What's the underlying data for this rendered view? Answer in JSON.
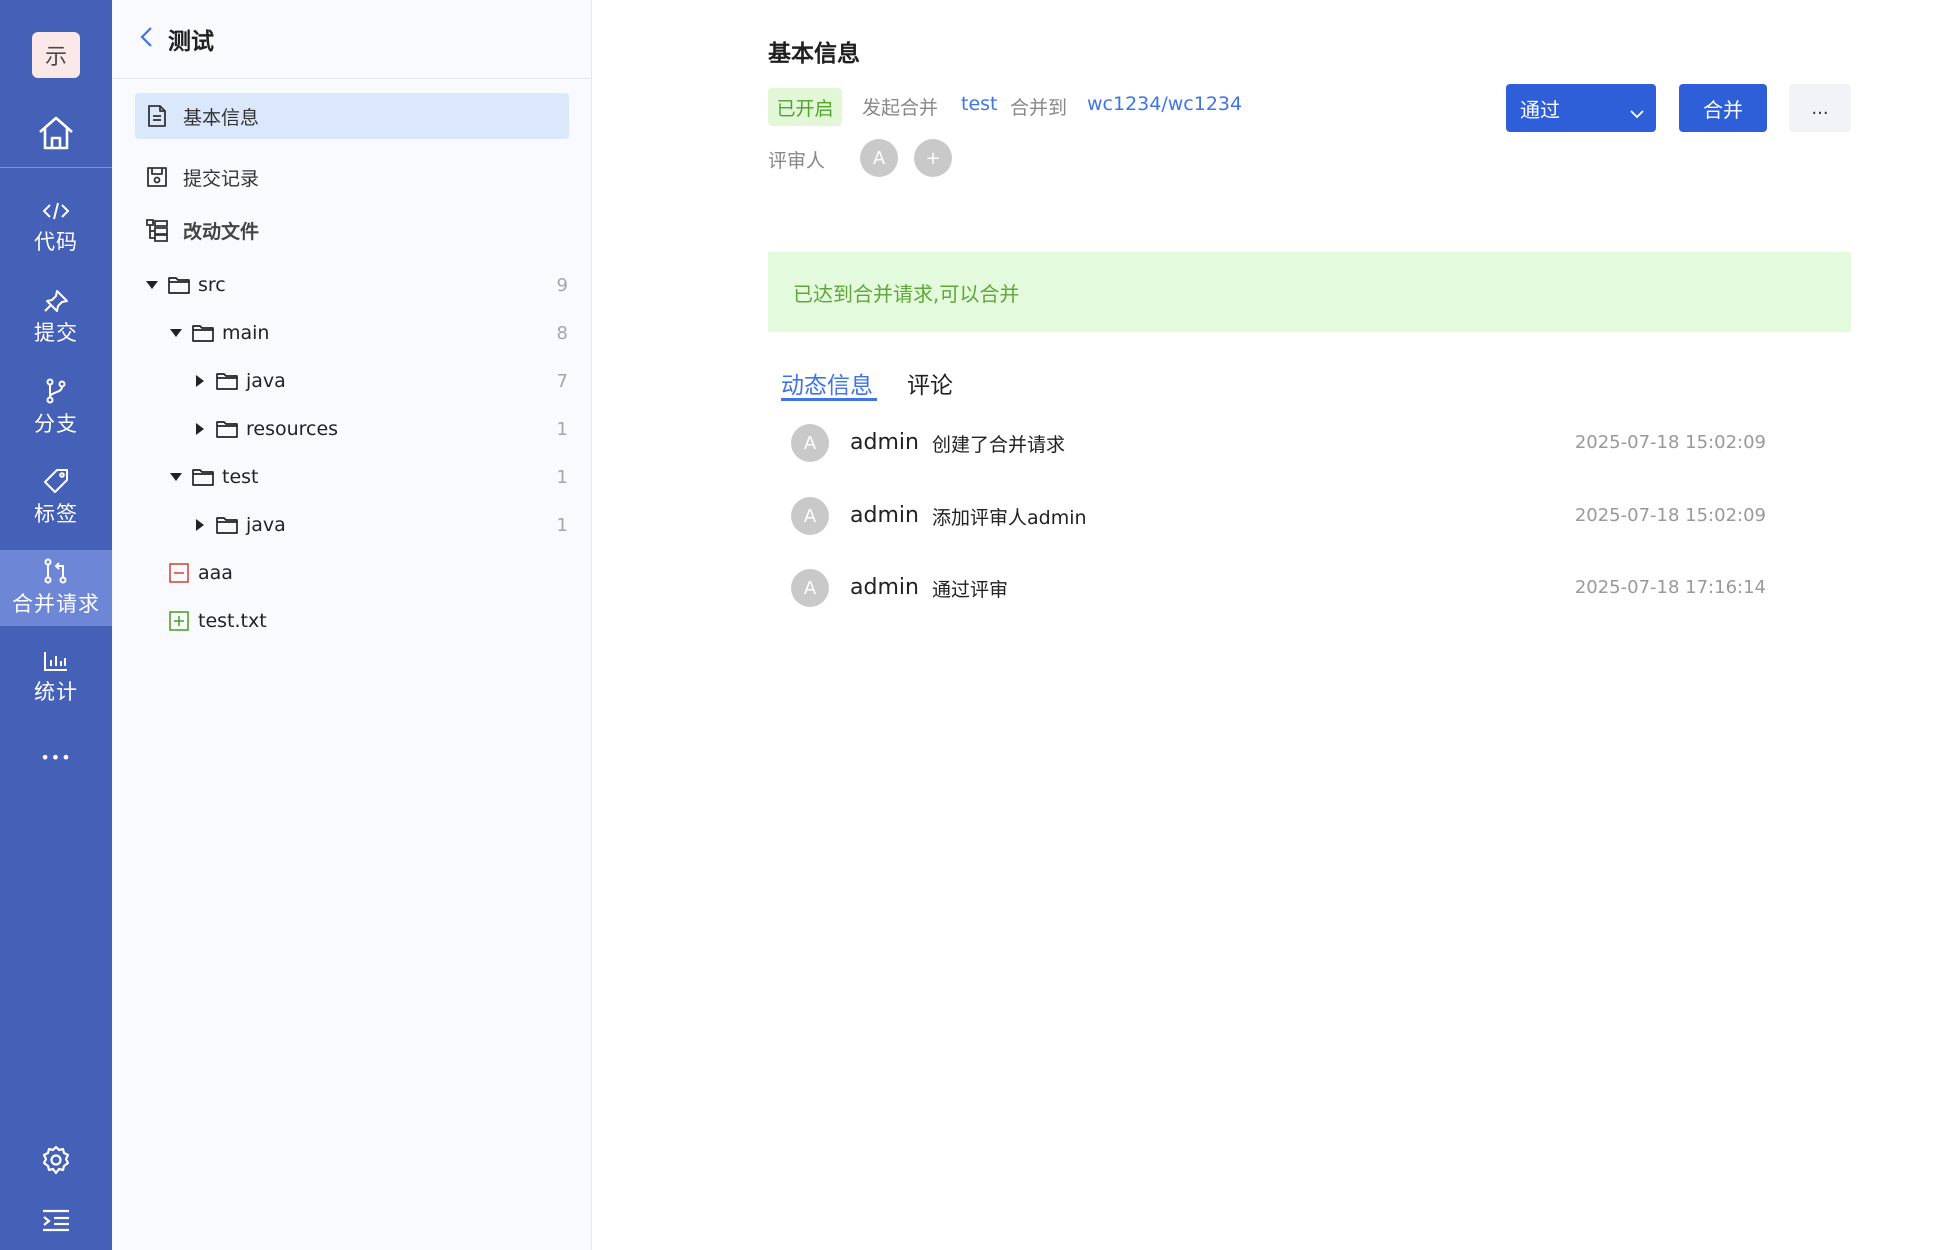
{
  "rail": {
    "logo": "示",
    "items": [
      {
        "label": "代码",
        "icon": "code-icon"
      },
      {
        "label": "提交",
        "icon": "pin-icon"
      },
      {
        "label": "分支",
        "icon": "branch-icon"
      },
      {
        "label": "标签",
        "icon": "tag-icon"
      },
      {
        "label": "合并请求",
        "icon": "merge-request-icon",
        "active": true
      },
      {
        "label": "统计",
        "icon": "chart-icon"
      }
    ],
    "more": "•••"
  },
  "panel": {
    "title": "测试",
    "nav": [
      {
        "label": "基本信息",
        "icon": "document-icon",
        "active": true
      },
      {
        "label": "提交记录",
        "icon": "commit-record-icon"
      },
      {
        "label": "改动文件",
        "icon": "file-tree-icon"
      }
    ],
    "tree": [
      {
        "name": "src",
        "type": "folder",
        "state": "expanded",
        "count": "9"
      },
      {
        "name": "main",
        "type": "folder",
        "state": "expanded",
        "count": "8"
      },
      {
        "name": "java",
        "type": "folder",
        "state": "collapsed",
        "count": "7"
      },
      {
        "name": "resources",
        "type": "folder",
        "state": "collapsed",
        "count": "1"
      },
      {
        "name": "test",
        "type": "folder",
        "state": "expanded",
        "count": "1"
      },
      {
        "name": "java",
        "type": "folder",
        "state": "collapsed",
        "count": "1"
      },
      {
        "name": "aaa",
        "type": "file-deleted",
        "count": ""
      },
      {
        "name": "test.txt",
        "type": "file-added",
        "count": ""
      }
    ]
  },
  "main": {
    "section_title": "基本信息",
    "status": "已开启",
    "initiated_label": "发起合并",
    "source_branch": "test",
    "merge_to_label": "合并到",
    "target": "wc1234/wc1234",
    "reviewer_label": "评审人",
    "reviewer_avatar": "A",
    "add_reviewer": "+",
    "approve_button": "通过",
    "merge_button": "合并",
    "more_button": "...",
    "notice": "已达到合并请求,可以合并",
    "tabs": [
      "动态信息",
      "评论"
    ],
    "activities": [
      {
        "avatar": "A",
        "user": "admin",
        "action": "创建了合并请求",
        "time": "2025-07-18 15:02:09"
      },
      {
        "avatar": "A",
        "user": "admin",
        "action": "添加评审人admin",
        "time": "2025-07-18 15:02:09"
      },
      {
        "avatar": "A",
        "user": "admin",
        "action": "通过评审",
        "time": "2025-07-18 17:16:14"
      }
    ]
  },
  "colors": {
    "rail_bg": "#4560b7",
    "rail_active": "#6e86d6",
    "accent": "#2f5fd8",
    "link": "#3f74e6",
    "success_bg": "#e3fbdc",
    "success_text": "#61a63a"
  }
}
